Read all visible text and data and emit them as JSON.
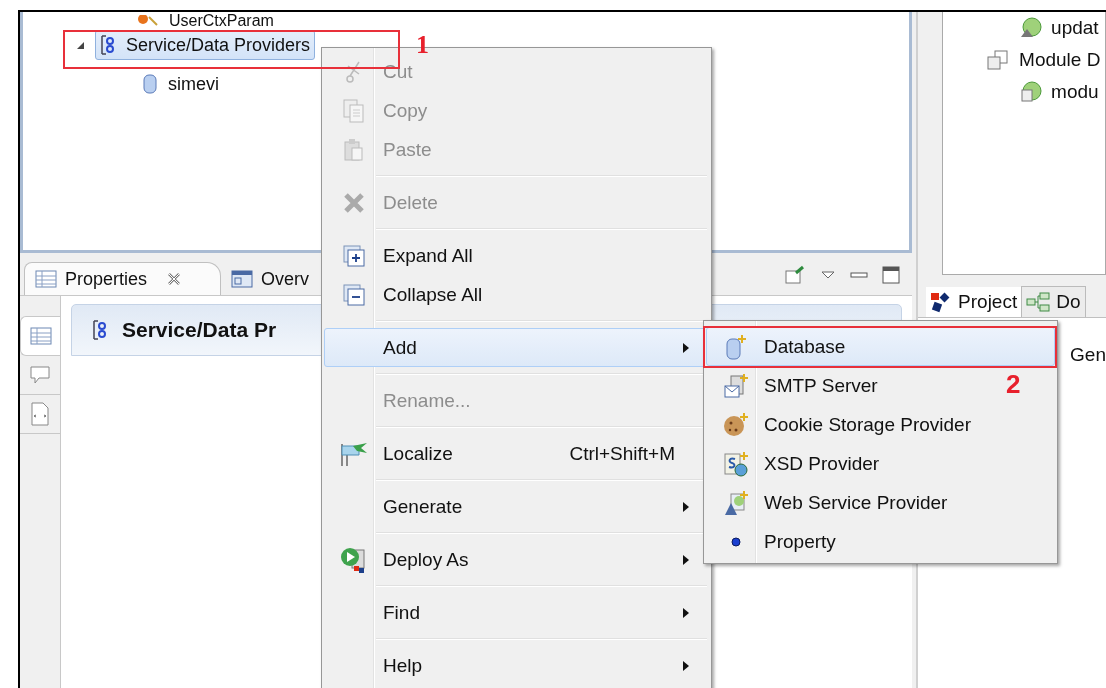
{
  "tree": {
    "items": [
      {
        "label": "UserCtxParam",
        "kind": "param",
        "selected": false
      },
      {
        "label": "Service/Data Providers",
        "kind": "providers",
        "selected": true,
        "expanded": true,
        "children": [
          {
            "label": "simevi",
            "kind": "database",
            "selected": false
          }
        ]
      }
    ]
  },
  "properties_view": {
    "tabs": [
      {
        "label": "Properties",
        "kind": "properties",
        "selected": true
      },
      {
        "label": "Overv",
        "kind": "overview",
        "selected": false
      }
    ],
    "side_tabs": [
      {
        "kind": "table",
        "selected": true
      },
      {
        "kind": "comment",
        "selected": false
      },
      {
        "kind": "source",
        "selected": false
      }
    ],
    "heading": "Service/Data Pr"
  },
  "right_view": {
    "tree": [
      {
        "label": "updat",
        "kind": "web-service"
      },
      {
        "label": "Module D",
        "kind": "module",
        "children": [
          {
            "label": "modu",
            "kind": "web-module"
          }
        ]
      }
    ],
    "tabs": [
      {
        "label": "Project",
        "kind": "project",
        "selected": true
      },
      {
        "label": "Do",
        "kind": "diagram",
        "selected": false
      }
    ],
    "column_1": "Gen"
  },
  "context_menu": {
    "groups": [
      [
        {
          "label": "Cut",
          "kind": "cut",
          "disabled": true,
          "selected": false
        },
        {
          "label": "Copy",
          "kind": "copy",
          "disabled": true,
          "selected": false
        },
        {
          "label": "Paste",
          "kind": "paste",
          "disabled": true,
          "selected": false
        }
      ],
      [
        {
          "label": "Delete",
          "kind": "delete",
          "disabled": true,
          "selected": false
        }
      ],
      [
        {
          "label": "Expand All",
          "kind": "expand",
          "disabled": false,
          "selected": false
        },
        {
          "label": "Collapse All",
          "kind": "collapse",
          "disabled": false,
          "selected": false
        }
      ],
      [
        {
          "label": "Add",
          "kind": "none",
          "disabled": false,
          "selected": true,
          "submenu": true
        }
      ],
      [
        {
          "label": "Rename...",
          "kind": "none",
          "disabled": true,
          "selected": false
        }
      ],
      [
        {
          "label": "Localize",
          "kind": "localize",
          "disabled": false,
          "selected": false,
          "shortcut": "Ctrl+Shift+M"
        }
      ],
      [
        {
          "label": "Generate",
          "kind": "none",
          "disabled": false,
          "selected": false,
          "submenu": true
        }
      ],
      [
        {
          "label": "Deploy As",
          "kind": "deploy",
          "disabled": false,
          "selected": false,
          "submenu": true
        }
      ],
      [
        {
          "label": "Find",
          "kind": "none",
          "disabled": false,
          "selected": false,
          "submenu": true
        }
      ],
      [
        {
          "label": "Help",
          "kind": "none",
          "disabled": false,
          "selected": false,
          "submenu": true
        }
      ]
    ]
  },
  "submenu": {
    "items": [
      {
        "label": "Database",
        "kind": "database",
        "selected": true
      },
      {
        "label": "SMTP Server",
        "kind": "smtp",
        "selected": false
      },
      {
        "label": "Cookie Storage Provider",
        "kind": "cookie",
        "selected": false
      },
      {
        "label": "XSD Provider",
        "kind": "xsd",
        "selected": false
      },
      {
        "label": "Web Service Provider",
        "kind": "webservice",
        "selected": false
      },
      {
        "label": "Property",
        "kind": "property",
        "selected": false
      }
    ]
  },
  "annotations": [
    {
      "label": "1"
    },
    {
      "label": "2"
    }
  ]
}
